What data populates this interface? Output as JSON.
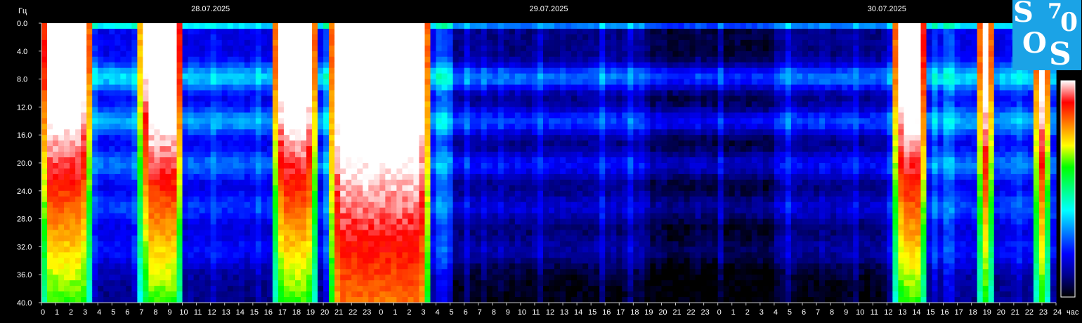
{
  "chart_data": {
    "type": "heatmap",
    "title": "",
    "ylabel": "Гц",
    "xlabel": "час",
    "ylim": [
      0,
      40
    ],
    "y_ticks": [
      "0.0",
      "4.0",
      "8.0",
      "12.0",
      "16.0",
      "20.0",
      "24.0",
      "28.0",
      "32.0",
      "36.0",
      "40.0"
    ],
    "x_ticks": [
      "0",
      "1",
      "2",
      "3",
      "4",
      "5",
      "6",
      "7",
      "8",
      "9",
      "10",
      "11",
      "12",
      "13",
      "14",
      "15",
      "16",
      "17",
      "18",
      "19",
      "20",
      "21",
      "22",
      "23",
      "0",
      "1",
      "2",
      "3",
      "4",
      "5",
      "6",
      "7",
      "8",
      "9",
      "10",
      "11",
      "12",
      "13",
      "14",
      "15",
      "16",
      "17",
      "18",
      "19",
      "20",
      "21",
      "22",
      "23",
      "0",
      "1",
      "2",
      "3",
      "4",
      "5",
      "6",
      "7",
      "8",
      "9",
      "10",
      "11",
      "12",
      "13",
      "14",
      "15",
      "16",
      "17",
      "18",
      "19",
      "20",
      "21",
      "22",
      "23",
      "24"
    ],
    "dates": [
      "28.07.2025",
      "29.07.2025",
      "30.07.2025"
    ],
    "colorscale": [
      "#000000",
      "#00008c",
      "#0000ff",
      "#0080ff",
      "#00ffff",
      "#00ff80",
      "#00ff00",
      "#ffff00",
      "#ff8000",
      "#ff0000",
      "#ffffff"
    ],
    "resonance_bands_hz": [
      7.8,
      14.1,
      20.3,
      26.4,
      32.5
    ],
    "high_intensity_periods": [
      {
        "day": "28.07.2025",
        "start_hour": 0,
        "end_hour": 3.5
      },
      {
        "day": "28.07.2025",
        "start_hour": 7,
        "end_hour": 10
      },
      {
        "day": "28.07.2025",
        "start_hour": 16.5,
        "end_hour": 19.5
      },
      {
        "day": "28.07.2025",
        "start_hour": 20.5,
        "end_hour": 27.5
      },
      {
        "day": "30.07.2025",
        "start_hour": 12.5,
        "end_hour": 14.8
      },
      {
        "day": "30.07.2025",
        "start_hour": 18.5,
        "end_hour": 19.5
      },
      {
        "day": "30.07.2025",
        "start_hour": 22.5,
        "end_hour": 23.5
      }
    ]
  },
  "logo": {
    "l1": "S",
    "l2": "7",
    "l3": "0",
    "l4": "O",
    "l5": "S"
  }
}
